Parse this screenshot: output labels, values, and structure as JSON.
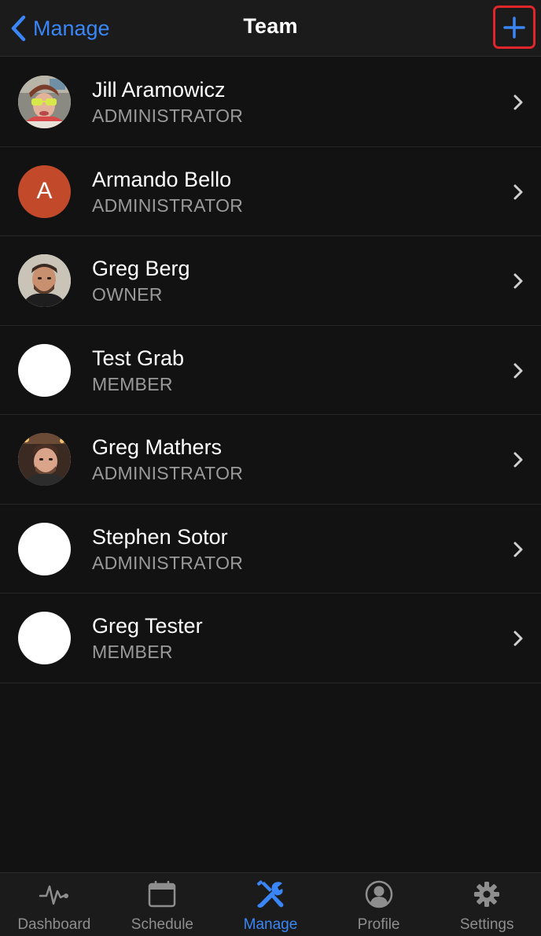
{
  "header": {
    "back_label": "Manage",
    "title": "Team",
    "add_icon": "plus-icon",
    "back_icon": "chevron-left-icon"
  },
  "team": {
    "members": [
      {
        "name": "Jill Aramowicz",
        "role": "ADMINISTRATOR",
        "avatar": "photo"
      },
      {
        "name": "Armando Bello",
        "role": "ADMINISTRATOR",
        "avatar": "initial",
        "initial": "A",
        "avatar_color": "#c24a2b"
      },
      {
        "name": "Greg Berg",
        "role": "OWNER",
        "avatar": "photo"
      },
      {
        "name": "Test Grab",
        "role": "MEMBER",
        "avatar": "blank"
      },
      {
        "name": "Greg Mathers",
        "role": "ADMINISTRATOR",
        "avatar": "photo"
      },
      {
        "name": "Stephen Sotor",
        "role": "ADMINISTRATOR",
        "avatar": "blank"
      },
      {
        "name": "Greg Tester",
        "role": "MEMBER",
        "avatar": "blank"
      }
    ]
  },
  "tabs": [
    {
      "label": "Dashboard",
      "icon": "pulse-icon",
      "active": false
    },
    {
      "label": "Schedule",
      "icon": "calendar-icon",
      "active": false
    },
    {
      "label": "Manage",
      "icon": "tools-icon",
      "active": true
    },
    {
      "label": "Profile",
      "icon": "person-icon",
      "active": false
    },
    {
      "label": "Settings",
      "icon": "gear-icon",
      "active": false
    }
  ],
  "colors": {
    "accent": "#3a86f7",
    "background": "#121212",
    "bar_background": "#1b1b1b",
    "highlight_border": "#e0262b",
    "secondary_text": "#9a9a9a",
    "inactive_tab": "#8e8e8e"
  }
}
